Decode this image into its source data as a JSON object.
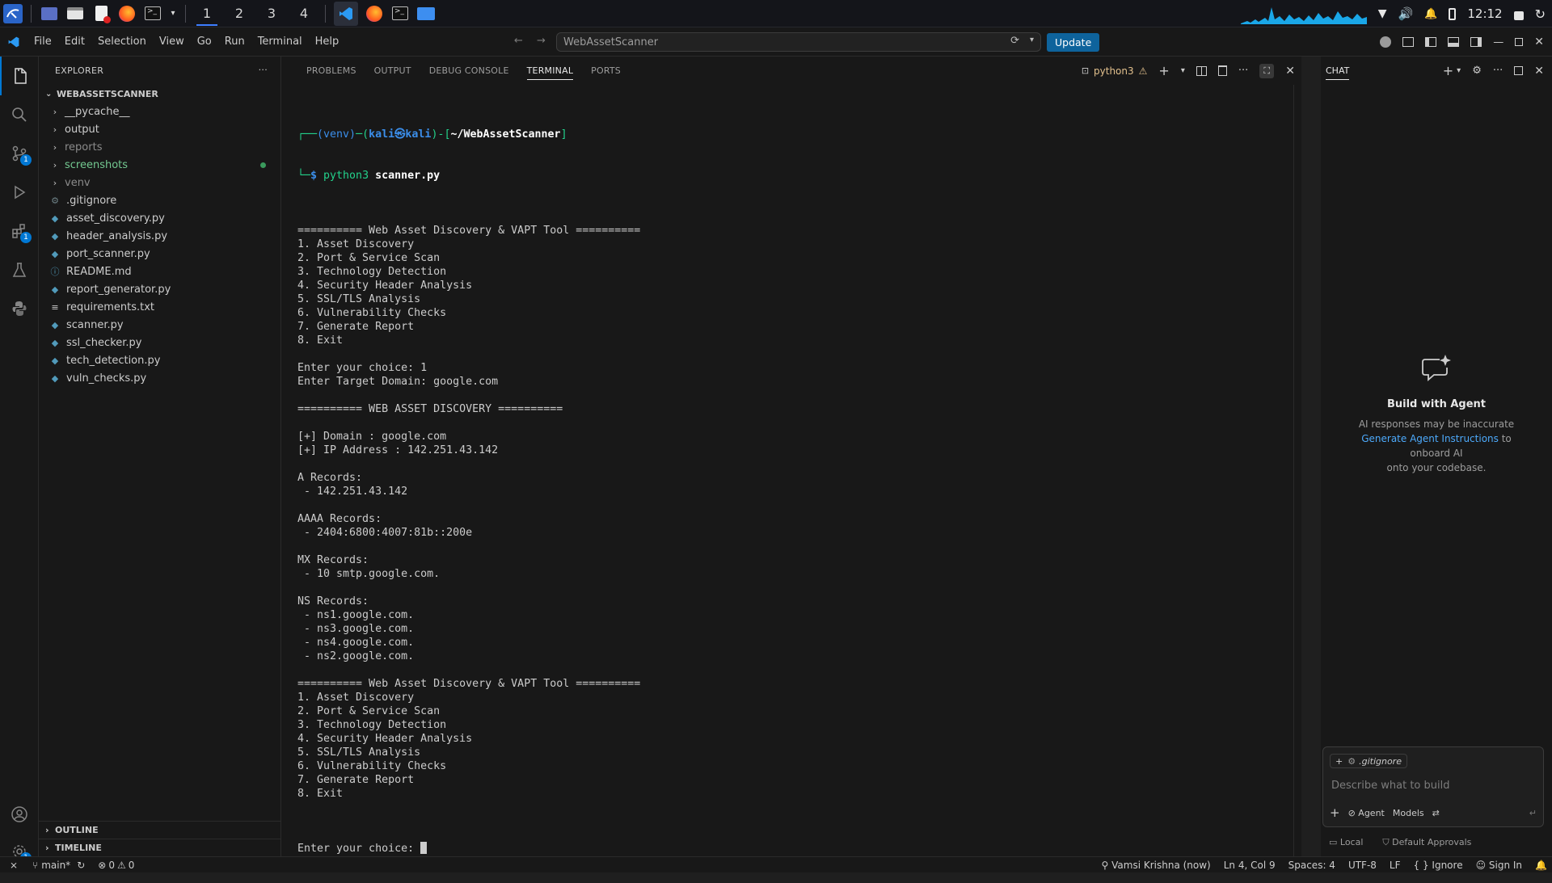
{
  "taskbar": {
    "workspaces": [
      "1",
      "2",
      "3",
      "4"
    ],
    "active_workspace": "1",
    "clock": "12:12",
    "icons": [
      "kali-menu-icon",
      "desktop-icon",
      "files-icon",
      "text-editor-icon",
      "firefox-icon",
      "terminal-icon",
      "vscode-icon",
      "firefox-icon",
      "terminal-icon",
      "folder-icon"
    ]
  },
  "menubar": {
    "items": [
      "File",
      "Edit",
      "Selection",
      "View",
      "Go",
      "Run",
      "Terminal",
      "Help"
    ],
    "search_text": "WebAssetScanner",
    "update_label": "Update"
  },
  "activity_bar": {
    "source_control_badge": "1",
    "extensions_badge": "1",
    "settings_badge": "1"
  },
  "explorer": {
    "title": "EXPLORER",
    "project": "WEBASSETSCANNER",
    "folders": [
      "__pycache__",
      "output",
      "reports",
      "screenshots",
      "venv"
    ],
    "files": [
      {
        "name": ".gitignore",
        "icon": "gear"
      },
      {
        "name": "asset_discovery.py",
        "icon": "py"
      },
      {
        "name": "header_analysis.py",
        "icon": "py"
      },
      {
        "name": "port_scanner.py",
        "icon": "py"
      },
      {
        "name": "README.md",
        "icon": "info"
      },
      {
        "name": "report_generator.py",
        "icon": "py"
      },
      {
        "name": "requirements.txt",
        "icon": "txt"
      },
      {
        "name": "scanner.py",
        "icon": "py"
      },
      {
        "name": "ssl_checker.py",
        "icon": "py"
      },
      {
        "name": "tech_detection.py",
        "icon": "py"
      },
      {
        "name": "vuln_checks.py",
        "icon": "py"
      }
    ],
    "outline": "OUTLINE",
    "timeline": "TIMELINE"
  },
  "panel": {
    "tabs": [
      "PROBLEMS",
      "OUTPUT",
      "DEBUG CONSOLE",
      "TERMINAL",
      "PORTS"
    ],
    "active_tab": "TERMINAL",
    "terminal_name": "python3"
  },
  "terminal": {
    "prompt_venv": "(venv)",
    "prompt_user": "kali㉿kali",
    "prompt_path": "~/WebAssetScanner",
    "command_prog": "python3",
    "command_arg": "scanner.py",
    "lines": [
      "",
      "========== Web Asset Discovery & VAPT Tool ==========",
      "1. Asset Discovery",
      "2. Port & Service Scan",
      "3. Technology Detection",
      "4. Security Header Analysis",
      "5. SSL/TLS Analysis",
      "6. Vulnerability Checks",
      "7. Generate Report",
      "8. Exit",
      "",
      "Enter your choice: 1",
      "Enter Target Domain: google.com",
      "",
      "========== WEB ASSET DISCOVERY ==========",
      "",
      "[+] Domain : google.com",
      "[+] IP Address : 142.251.43.142",
      "",
      "A Records:",
      " - 142.251.43.142",
      "",
      "AAAA Records:",
      " - 2404:6800:4007:81b::200e",
      "",
      "MX Records:",
      " - 10 smtp.google.com.",
      "",
      "NS Records:",
      " - ns1.google.com.",
      " - ns3.google.com.",
      " - ns4.google.com.",
      " - ns2.google.com.",
      "",
      "========== Web Asset Discovery & VAPT Tool ==========",
      "1. Asset Discovery",
      "2. Port & Service Scan",
      "3. Technology Detection",
      "4. Security Header Analysis",
      "5. SSL/TLS Analysis",
      "6. Vulnerability Checks",
      "7. Generate Report",
      "8. Exit",
      ""
    ],
    "final_prompt": "Enter your choice: "
  },
  "chat": {
    "title": "CHAT",
    "heading": "Build with Agent",
    "line1": "AI responses may be inaccurate",
    "link": "Generate Agent Instructions",
    "line2a": " to onboard AI",
    "line2b": "onto your codebase.",
    "context_pill": ".gitignore",
    "placeholder": "Describe what to build",
    "agent_label": "Agent",
    "models_label": "Models",
    "local_label": "Local",
    "approvals_label": "Default Approvals"
  },
  "statusbar": {
    "branch": "main*",
    "errors": "0",
    "warnings": "0",
    "author": "Vamsi Krishna (now)",
    "position": "Ln 4, Col 9",
    "spaces": "Spaces: 4",
    "encoding": "UTF-8",
    "eol": "LF",
    "lang": "Ignore",
    "signin": "Sign In"
  },
  "colors": {
    "accent": "#0078d4",
    "prompt_green": "#23d18b",
    "prompt_blue": "#3b8eea"
  }
}
